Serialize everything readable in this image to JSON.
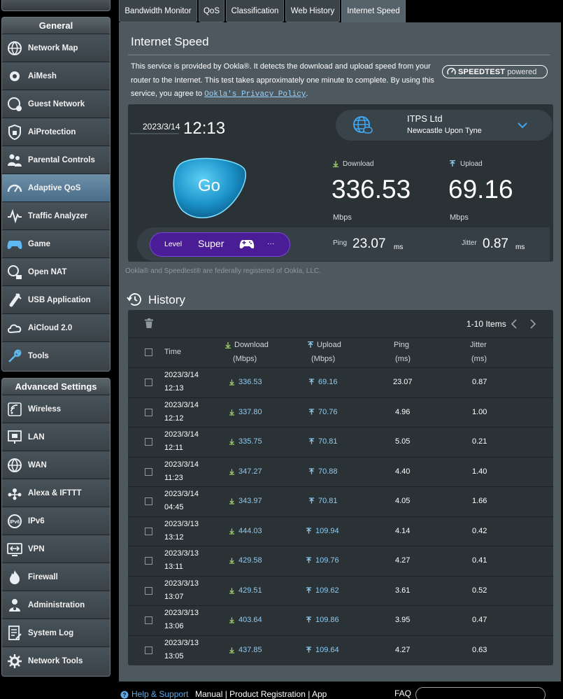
{
  "tabs": [
    {
      "label": "Bandwidth Monitor"
    },
    {
      "label": "QoS"
    },
    {
      "label": "Classification"
    },
    {
      "label": "Web History"
    },
    {
      "label": "Internet Speed"
    }
  ],
  "sidebar": {
    "general_heading": "General",
    "general_items": [
      {
        "label": "Network Map",
        "icon": "network-map-icon"
      },
      {
        "label": "AiMesh",
        "icon": "aimesh-icon"
      },
      {
        "label": "Guest Network",
        "icon": "guest-network-icon"
      },
      {
        "label": "AiProtection",
        "icon": "aiprotection-icon"
      },
      {
        "label": "Parental Controls",
        "icon": "parental-controls-icon"
      },
      {
        "label": "Adaptive QoS",
        "icon": "adaptive-qos-icon",
        "active": true
      },
      {
        "label": "Traffic Analyzer",
        "icon": "traffic-analyzer-icon"
      },
      {
        "label": "Game",
        "icon": "gamepad-icon"
      },
      {
        "label": "Open NAT",
        "icon": "open-nat-icon"
      },
      {
        "label": "USB Application",
        "icon": "usb-icon"
      },
      {
        "label": "AiCloud 2.0",
        "icon": "cloud-icon"
      },
      {
        "label": "Tools",
        "icon": "wrench-icon"
      }
    ],
    "advanced_heading": "Advanced Settings",
    "advanced_items": [
      {
        "label": "Wireless",
        "icon": "wireless-icon"
      },
      {
        "label": "LAN",
        "icon": "lan-icon"
      },
      {
        "label": "WAN",
        "icon": "wan-globe-icon"
      },
      {
        "label": "Alexa & IFTTT",
        "icon": "alexa-icon"
      },
      {
        "label": "IPv6",
        "icon": "ipv6-icon"
      },
      {
        "label": "VPN",
        "icon": "vpn-icon"
      },
      {
        "label": "Firewall",
        "icon": "firewall-icon"
      },
      {
        "label": "Administration",
        "icon": "administration-icon"
      },
      {
        "label": "System Log",
        "icon": "system-log-icon"
      },
      {
        "label": "Network Tools",
        "icon": "network-tools-icon"
      }
    ]
  },
  "page": {
    "title": "Internet Speed",
    "description_1": "This service is provided by Ookla®. It detects the download and upload speed from your router to the Internet. This test takes approximately one minute to complete. By using this service, you agree to ",
    "privacy_link": "Ookla's Privacy Policy",
    "description_end": ".",
    "logo_brand": "SPEEDTEST",
    "logo_suffix": "powered",
    "registered_note": "Ookla® and Speedtest® are federally registered of Ookla, LLC."
  },
  "result": {
    "date": "2023/3/14",
    "time": "12:13",
    "server_name": "ITPS Ltd",
    "server_city": "Newcastle Upon Tyne",
    "go_label": "Go",
    "download_label": "Download",
    "download_value": "336.53",
    "download_unit": "Mbps",
    "upload_label": "Upload",
    "upload_value": "69.16",
    "upload_unit": "Mbps",
    "level_label": "Level",
    "level_value": "Super",
    "level_more": "···",
    "ping_label": "Ping",
    "ping_value": "23.07",
    "ping_unit": "ms",
    "jitter_label": "Jitter",
    "jitter_value": "0.87",
    "jitter_unit": "ms"
  },
  "history": {
    "title": "History",
    "items_count": "1-10 Items",
    "headers": {
      "time": "Time",
      "download": "Download",
      "download_unit": "(Mbps)",
      "upload": "Upload",
      "upload_unit": "(Mbps)",
      "ping": "Ping",
      "ping_unit": "(ms)",
      "jitter": "Jitter",
      "jitter_unit": "(ms)"
    },
    "rows": [
      {
        "date": "2023/3/14",
        "time": "12:13",
        "download": "336.53",
        "upload": "69.16",
        "ping": "23.07",
        "jitter": "0.87"
      },
      {
        "date": "2023/3/14",
        "time": "12:12",
        "download": "337.80",
        "upload": "70.76",
        "ping": "4.96",
        "jitter": "1.00"
      },
      {
        "date": "2023/3/14",
        "time": "12:11",
        "download": "335.75",
        "upload": "70.81",
        "ping": "5.05",
        "jitter": "0.21"
      },
      {
        "date": "2023/3/14",
        "time": "11:23",
        "download": "347.27",
        "upload": "70.88",
        "ping": "4.40",
        "jitter": "1.40"
      },
      {
        "date": "2023/3/14",
        "time": "04:45",
        "download": "343.97",
        "upload": "70.81",
        "ping": "4.05",
        "jitter": "1.66"
      },
      {
        "date": "2023/3/13",
        "time": "13:12",
        "download": "444.03",
        "upload": "109.94",
        "ping": "4.14",
        "jitter": "0.42"
      },
      {
        "date": "2023/3/13",
        "time": "13:11",
        "download": "429.58",
        "upload": "109.76",
        "ping": "4.27",
        "jitter": "0.41"
      },
      {
        "date": "2023/3/13",
        "time": "13:07",
        "download": "429.51",
        "upload": "109.62",
        "ping": "3.61",
        "jitter": "0.52"
      },
      {
        "date": "2023/3/13",
        "time": "13:06",
        "download": "403.64",
        "upload": "109.86",
        "ping": "3.95",
        "jitter": "0.47"
      },
      {
        "date": "2023/3/13",
        "time": "13:05",
        "download": "437.85",
        "upload": "109.64",
        "ping": "4.27",
        "jitter": "0.63"
      }
    ]
  },
  "footer": {
    "help": "Help & Support",
    "links": "Manual | Product Registration | App",
    "faq": "FAQ"
  },
  "colors": {
    "accent_blue": "#8fcbf2",
    "download_green": "#9ccc65",
    "level_purple": "#4a1d96",
    "panel_bg": "#4d585f",
    "card_bg": "#2a3236"
  }
}
